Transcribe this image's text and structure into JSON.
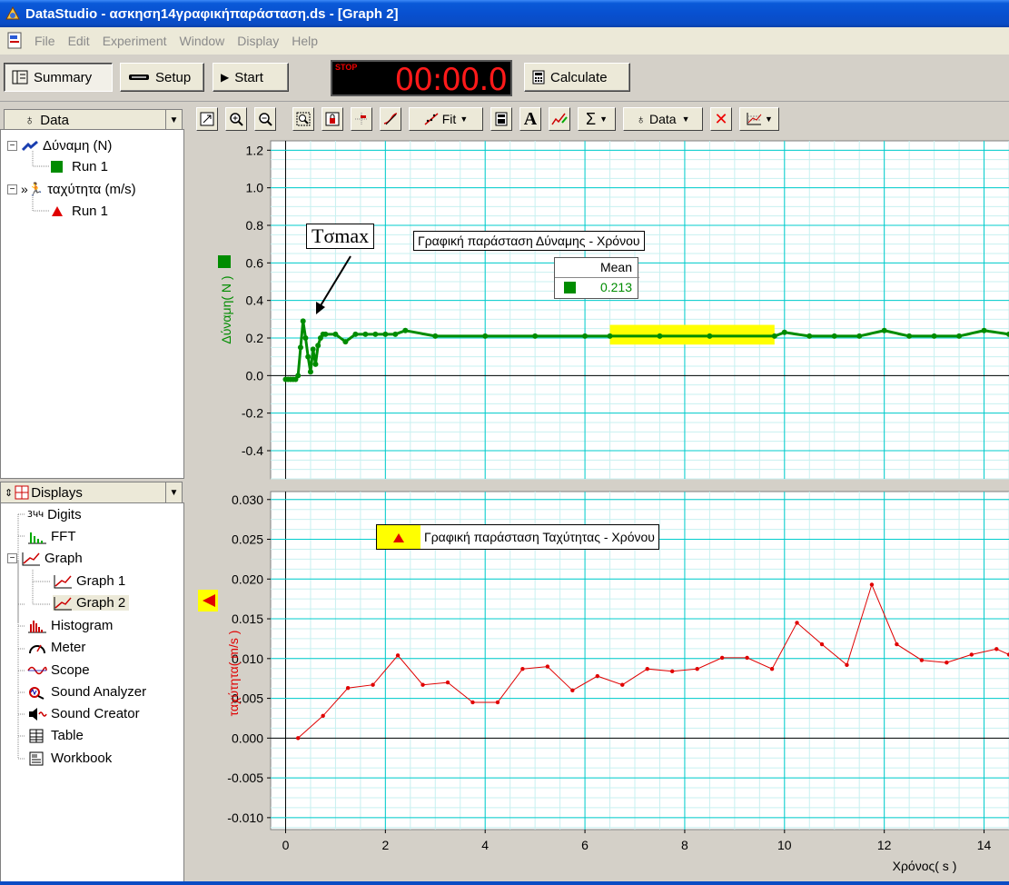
{
  "window": {
    "title": "DataStudio - ασκηση14γραφικήπαράσταση.ds - [Graph 2]"
  },
  "menu": [
    "File",
    "Edit",
    "Experiment",
    "Window",
    "Display",
    "Help"
  ],
  "toolbar": {
    "summary_label": "Summary",
    "setup_label": "Setup",
    "start_label": "Start",
    "stop_label": "STOP",
    "timer": "00:00.0",
    "calculate_label": "Calculate"
  },
  "data_panel": {
    "header": "Data",
    "items": [
      {
        "label": "Δύναμη (N)",
        "run": "Run 1"
      },
      {
        "label": "ταχύτητα (m/s)",
        "run": "Run 1"
      }
    ]
  },
  "displays_panel": {
    "header": "Displays",
    "items": [
      "Digits",
      "FFT",
      "Graph",
      "Graph 1",
      "Graph 2",
      "Histogram",
      "Meter",
      "Scope",
      "Sound Analyzer",
      "Sound Creator",
      "Table",
      "Workbook"
    ],
    "digits_icon_text": "ЗԿԿ"
  },
  "graph_toolbar": {
    "fit_label": "Fit",
    "text_tool": "A",
    "sigma": "Σ",
    "data_label": "Data"
  },
  "graph1": {
    "title": "Γραφική παράσταση Δύναμης - Χρόνου",
    "ylabel": "Δύναμη( N )",
    "annotation": "Tσmax",
    "stats_header": "Mean",
    "stats_value": "0.213",
    "yticks": [
      "1.2",
      "1.0",
      "0.8",
      "0.6",
      "0.4",
      "0.2",
      "0.0",
      "-0.2",
      "-0.4"
    ]
  },
  "graph2": {
    "title": "Γραφική παράσταση Ταχύτητας - Χρόνου",
    "ylabel": "ταχύτητα( m/s )",
    "yticks": [
      "0.030",
      "0.025",
      "0.020",
      "0.015",
      "0.010",
      "0.005",
      "0.000",
      "-0.005",
      "-0.010"
    ],
    "xlabel": "Χρόνος( s )",
    "xticks": [
      "0",
      "2",
      "4",
      "6",
      "8",
      "10",
      "12",
      "14"
    ]
  },
  "colors": {
    "force": "#008c00",
    "velocity": "#e00000",
    "grid_major": "#00cccc",
    "grid_minor": "#c8f0f0",
    "highlight": "#ffff00"
  },
  "chart_data": [
    {
      "type": "scatter",
      "title": "Γραφική παράσταση Δύναμης - Χρόνου",
      "ylabel": "Δύναμη( N )",
      "xlim": [
        -0.3,
        14.5
      ],
      "ylim": [
        -0.55,
        1.25
      ],
      "series": [
        {
          "name": "Run 1",
          "x": [
            0.0,
            0.05,
            0.1,
            0.15,
            0.2,
            0.25,
            0.3,
            0.35,
            0.4,
            0.45,
            0.5,
            0.55,
            0.6,
            0.65,
            0.7,
            0.75,
            0.8,
            1.0,
            1.2,
            1.4,
            1.6,
            1.8,
            2.0,
            2.2,
            2.4,
            3.0,
            4.0,
            5.0,
            6.0,
            6.5,
            7.5,
            8.5,
            9.8,
            10.0,
            10.5,
            11.0,
            11.5,
            12.0,
            12.5,
            13.0,
            13.5,
            14.0,
            14.5
          ],
          "y": [
            -0.02,
            -0.02,
            -0.02,
            -0.02,
            -0.02,
            0.0,
            0.15,
            0.29,
            0.2,
            0.1,
            0.02,
            0.14,
            0.06,
            0.16,
            0.2,
            0.22,
            0.22,
            0.22,
            0.18,
            0.22,
            0.22,
            0.22,
            0.22,
            0.22,
            0.24,
            0.21,
            0.21,
            0.21,
            0.21,
            0.21,
            0.21,
            0.21,
            0.21,
            0.23,
            0.21,
            0.21,
            0.21,
            0.24,
            0.21,
            0.21,
            0.21,
            0.24,
            0.22
          ]
        }
      ],
      "highlight_range_x": [
        6.5,
        9.8
      ],
      "stats": {
        "Mean": 0.213
      }
    },
    {
      "type": "line",
      "title": "Γραφική παράσταση Ταχύτητας - Χρόνου",
      "xlabel": "Χρόνος( s )",
      "ylabel": "ταχύτητα( m/s )",
      "xlim": [
        -0.3,
        14.5
      ],
      "ylim": [
        -0.0115,
        0.031
      ],
      "series": [
        {
          "name": "Run 1",
          "x": [
            0.25,
            0.75,
            1.25,
            1.75,
            2.25,
            2.75,
            3.25,
            3.75,
            4.25,
            4.75,
            5.25,
            5.75,
            6.25,
            6.75,
            7.25,
            7.75,
            8.25,
            8.75,
            9.25,
            9.75,
            10.25,
            10.75,
            11.25,
            11.75,
            12.25,
            12.75,
            13.25,
            13.75,
            14.25,
            14.5
          ],
          "y": [
            0.0,
            0.0028,
            0.0063,
            0.0067,
            0.0104,
            0.0067,
            0.007,
            0.0045,
            0.0045,
            0.0087,
            0.009,
            0.006,
            0.0078,
            0.0067,
            0.0087,
            0.0084,
            0.0087,
            0.0101,
            0.0101,
            0.0087,
            0.0145,
            0.0118,
            0.0092,
            0.0193,
            0.0118,
            0.0098,
            0.0095,
            0.0105,
            0.0112,
            0.0105
          ]
        }
      ]
    }
  ]
}
